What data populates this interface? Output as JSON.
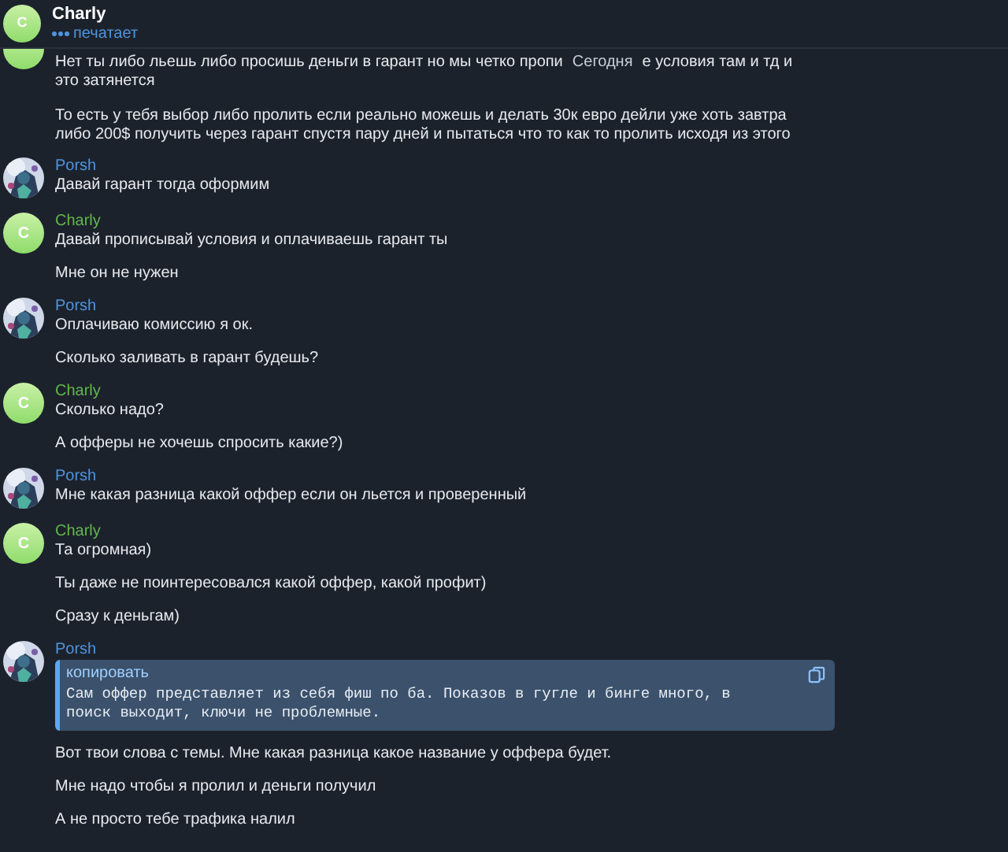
{
  "header": {
    "avatar_letter": "C",
    "name": "Charly",
    "status": "печатает",
    "typing": true
  },
  "date_badge": "Сегодня",
  "first_group": {
    "line_before_badge": "Нет ты либо льешь либо просишь деньги в гарант но мы четко пропи",
    "line_after_badge": "е условия там и тд и",
    "continuation": "это затянется",
    "messages": [
      "То есть у тебя выбор либо пролить если реально можешь и делать 30к евро дейли уже хоть завтра либо 200$ получить через гарант спустя пару дней и пытаться что то как то пролить исходя из этого"
    ]
  },
  "groups": [
    {
      "sender": "Porsh",
      "avatar": {
        "kind": "picture"
      },
      "color": "#4f94dc",
      "messages": [
        {
          "kind": "text",
          "text": "Давай гарант тогда оформим"
        }
      ]
    },
    {
      "sender": "Charly",
      "avatar": {
        "kind": "letter",
        "letter": "C"
      },
      "color": "#62b84c",
      "messages": [
        {
          "kind": "text",
          "text": "Давай прописывай условия и оплачиваешь гарант ты"
        },
        {
          "kind": "text",
          "text": "Мне он не нужен"
        }
      ]
    },
    {
      "sender": "Porsh",
      "avatar": {
        "kind": "picture"
      },
      "color": "#4f94dc",
      "messages": [
        {
          "kind": "text",
          "text": "Оплачиваю комиссию я ок."
        },
        {
          "kind": "text",
          "text": "Сколько заливать в гарант будешь?"
        }
      ]
    },
    {
      "sender": "Charly",
      "avatar": {
        "kind": "letter",
        "letter": "C"
      },
      "color": "#62b84c",
      "messages": [
        {
          "kind": "text",
          "text": "Сколько надо?"
        },
        {
          "kind": "text",
          "text": "А офферы не хочешь спросить какие?)"
        }
      ]
    },
    {
      "sender": "Porsh",
      "avatar": {
        "kind": "picture"
      },
      "color": "#4f94dc",
      "messages": [
        {
          "kind": "text",
          "text": "Мне какая разница какой оффер если он льется и проверенный"
        }
      ]
    },
    {
      "sender": "Charly",
      "avatar": {
        "kind": "letter",
        "letter": "C"
      },
      "color": "#62b84c",
      "messages": [
        {
          "kind": "text",
          "text": "Та огромная)"
        },
        {
          "kind": "text",
          "text": "Ты даже не поинтересовался какой оффер, какой профит)"
        },
        {
          "kind": "text",
          "text": "Сразу к деньгам)"
        }
      ]
    },
    {
      "sender": "Porsh",
      "avatar": {
        "kind": "picture"
      },
      "color": "#4f94dc",
      "messages": [
        {
          "kind": "code",
          "label": "копировать",
          "text": "Сам оффер представляет из себя фиш по ба. Показов в гугле и бинге много, в\nпоиск выходит, ключи не проблемные."
        },
        {
          "kind": "text",
          "text": "Вот твои слова с темы. Мне какая разница какое название у оффера будет."
        },
        {
          "kind": "text",
          "text": "Мне надо чтобы я пролил и деньги получил"
        },
        {
          "kind": "text",
          "text": "А не просто тебе трафика налил"
        }
      ]
    }
  ]
}
